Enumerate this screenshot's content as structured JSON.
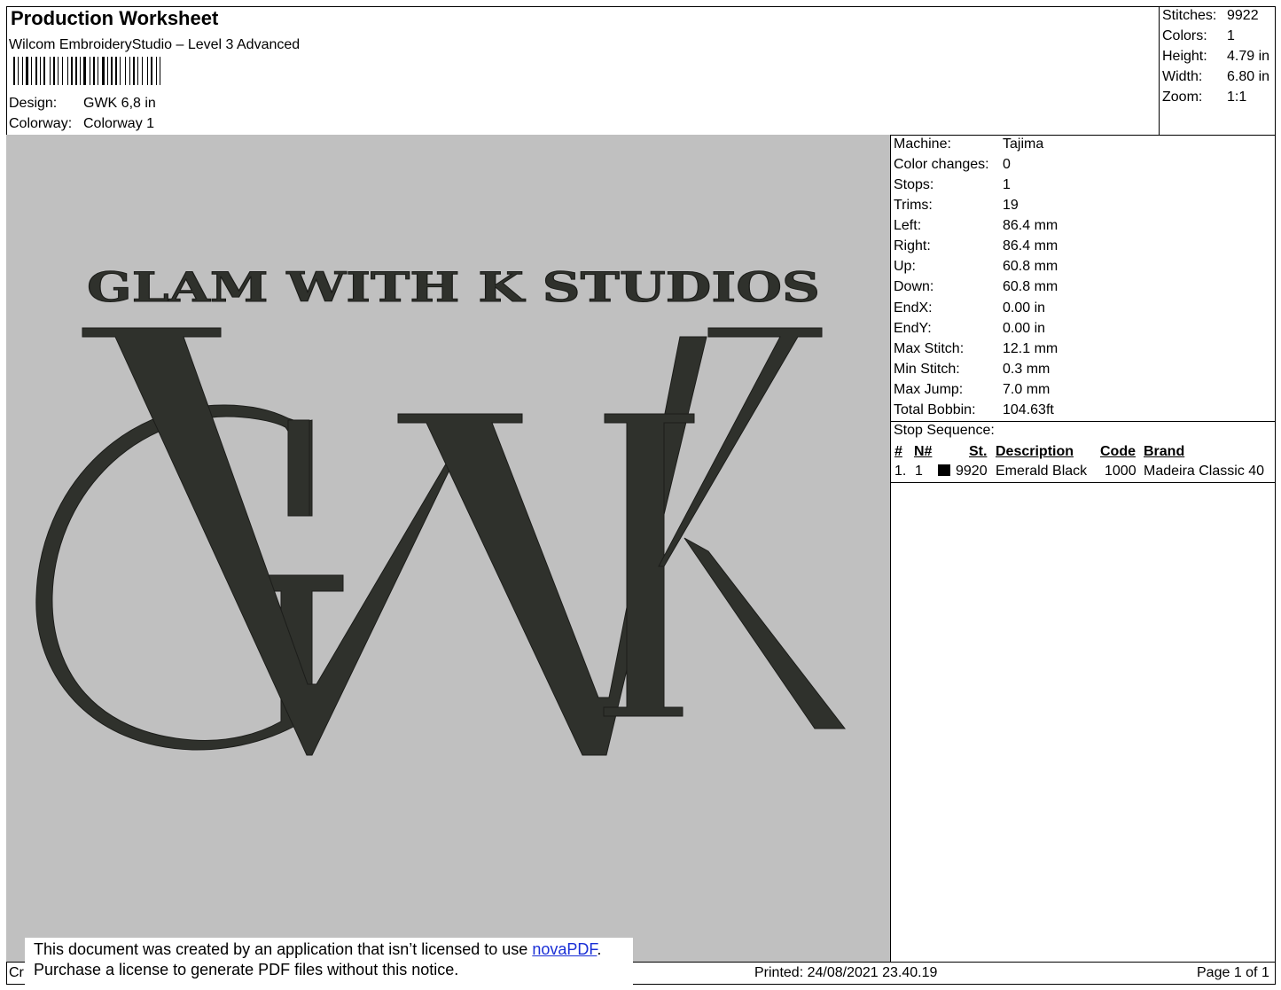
{
  "header": {
    "title": "Production Worksheet",
    "software": "Wilcom EmbroideryStudio – Level 3 Advanced",
    "barcode_text": "",
    "design_label": "Design:",
    "design_value": "GWK 6,8 in",
    "colorway_label": "Colorway:",
    "colorway_value": "Colorway 1"
  },
  "summary": [
    {
      "label": "Stitches:",
      "value": "9922"
    },
    {
      "label": "Colors:",
      "value": "1"
    },
    {
      "label": "Height:",
      "value": "4.79 in"
    },
    {
      "label": "Width:",
      "value": "6.80 in"
    },
    {
      "label": "Zoom:",
      "value": "1:1"
    }
  ],
  "machine_info": [
    {
      "label": "Machine:",
      "value": "Tajima"
    },
    {
      "label": "Color changes:",
      "value": "0"
    },
    {
      "label": "Stops:",
      "value": "1"
    },
    {
      "label": "Trims:",
      "value": "19"
    },
    {
      "label": "Left:",
      "value": "86.4 mm"
    },
    {
      "label": "Right:",
      "value": "86.4 mm"
    },
    {
      "label": "Up:",
      "value": "60.8 mm"
    },
    {
      "label": "Down:",
      "value": "60.8 mm"
    },
    {
      "label": "EndX:",
      "value": "0.00 in"
    },
    {
      "label": "EndY:",
      "value": "0.00 in"
    },
    {
      "label": "Max Stitch:",
      "value": "12.1 mm"
    },
    {
      "label": "Min Stitch:",
      "value": "0.3 mm"
    },
    {
      "label": "Max Jump:",
      "value": "7.0 mm"
    },
    {
      "label": "Total Bobbin:",
      "value": "104.63ft"
    }
  ],
  "stop_sequence": {
    "title": "Stop Sequence:",
    "headers": {
      "num": "#",
      "n": "N#",
      "st": "St.",
      "desc": "Description",
      "code": "Code",
      "brand": "Brand"
    },
    "rows": [
      {
        "num": "1.",
        "n": "1",
        "color": "#000000",
        "st": "9920",
        "desc": "Emerald Black",
        "code": "1000",
        "brand": "Madeira Classic 40"
      }
    ]
  },
  "design": {
    "background": "#c0c0c0",
    "thread_color": "#2f312c",
    "top_text": "GLAM WITH K STUDIOS",
    "monogram": "GWK"
  },
  "footer": {
    "left_partial": "Cr",
    "printed": "Printed: 24/08/2021 23.40.19",
    "page": "Page 1 of 1"
  },
  "notice": {
    "line1_prefix": "This document was created by an application that isn’t licensed to use ",
    "link": "novaPDF",
    "line1_suffix": ".",
    "line2": "Purchase a license to generate PDF files without this notice."
  }
}
